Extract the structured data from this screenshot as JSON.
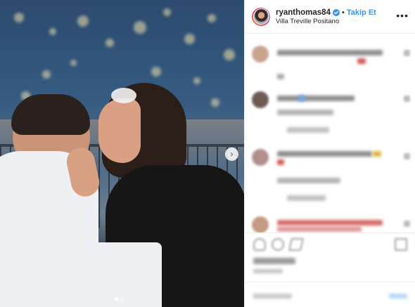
{
  "post": {
    "username": "ryanthomas84",
    "separator": "•",
    "follow_label": "Takip Et",
    "location": "Villa Treville Positano",
    "more_label": "•••",
    "verified_icon": "verified-badge-icon",
    "next_icon": "chevron-right-icon",
    "next_label": "›"
  },
  "carousel": {
    "slides": 2,
    "active_index": 0
  },
  "colors": {
    "follow": "#3897f0",
    "verified": "#3897f0",
    "text": "#262626",
    "divider": "#efefef"
  }
}
